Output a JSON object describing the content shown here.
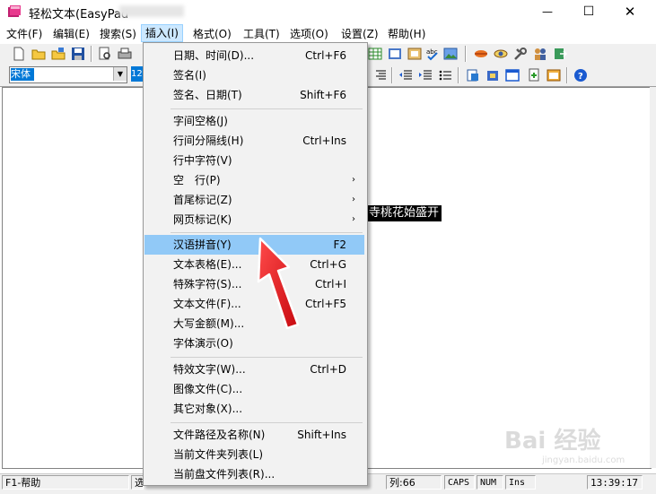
{
  "window": {
    "title": "轻松文本(EasyPad",
    "minimize": "—",
    "maximize": "☐",
    "close": "✕"
  },
  "menubar": [
    {
      "label": "文件(F)"
    },
    {
      "label": "编辑(E)"
    },
    {
      "label": "搜索(S)"
    },
    {
      "label": "插入(I)"
    },
    {
      "label": "格式(O)"
    },
    {
      "label": "工具(T)"
    },
    {
      "label": "选项(O)"
    },
    {
      "label": "设置(Z)"
    },
    {
      "label": "帮助(H)"
    }
  ],
  "toolbar": {
    "font_name": "宋体",
    "font_size": "12",
    "dropdown_arrow": "▼"
  },
  "editor": {
    "visible_text": "寺桃花始盛开"
  },
  "insert_menu": {
    "items": [
      {
        "label": "日期、时间(D)...",
        "shortcut": "Ctrl+F6"
      },
      {
        "label": "签名(I)",
        "shortcut": ""
      },
      {
        "label": "签名、日期(T)",
        "shortcut": "Shift+F6"
      },
      {
        "label": "字间空格(J)",
        "shortcut": ""
      },
      {
        "label": "行间分隔线(H)",
        "shortcut": "Ctrl+Ins"
      },
      {
        "label": "行中字符(V)",
        "shortcut": ""
      },
      {
        "label": "空　行(P)",
        "shortcut": "",
        "submenu": "›"
      },
      {
        "label": "首尾标记(Z)",
        "shortcut": "",
        "submenu": "›"
      },
      {
        "label": "网页标记(K)",
        "shortcut": "",
        "submenu": "›"
      },
      {
        "label": "汉语拼音(Y)",
        "shortcut": "F2",
        "highlighted": true
      },
      {
        "label": "文本表格(E)...",
        "shortcut": "Ctrl+G"
      },
      {
        "label": "特殊字符(S)...",
        "shortcut": "Ctrl+I"
      },
      {
        "label": "文本文件(F)...",
        "shortcut": "Ctrl+F5"
      },
      {
        "label": "大写金额(M)...",
        "shortcut": ""
      },
      {
        "label": "字体演示(O)",
        "shortcut": ""
      },
      {
        "label": "特效文字(W)...",
        "shortcut": "Ctrl+D"
      },
      {
        "label": "图像文件(C)...",
        "shortcut": ""
      },
      {
        "label": "其它对象(X)...",
        "shortcut": ""
      },
      {
        "label": "文件路径及名称(N)",
        "shortcut": "Shift+Ins"
      },
      {
        "label": "当前文件夹列表(L)",
        "shortcut": ""
      },
      {
        "label": "当前盘文件列表(R)...",
        "shortcut": ""
      }
    ]
  },
  "statusbar": {
    "help": "F1-帮助",
    "line_prefix": "选",
    "column": "列:66",
    "caps": "CAPS",
    "num": "NUM",
    "ins": "Ins",
    "time": "13:39:17"
  },
  "watermark": {
    "text": "Bai 经验",
    "sub": "jingyan.baidu.com"
  },
  "colors": {
    "menu_highlight": "#91c9f7",
    "menu_open_bg": "#cce8ff",
    "arrow": "#e8141a",
    "selection": "#000000"
  }
}
